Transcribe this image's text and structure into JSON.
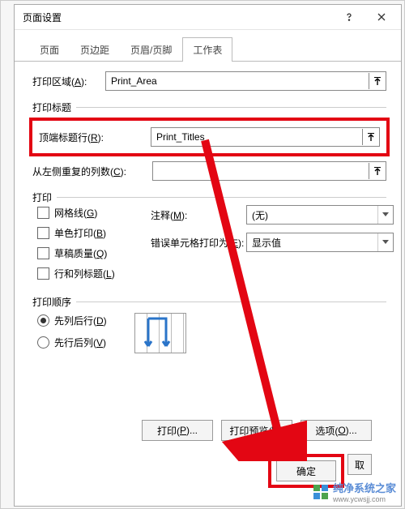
{
  "title": "页面设置",
  "tabs": [
    "页面",
    "页边距",
    "页眉/页脚",
    "工作表"
  ],
  "active_tab_index": 3,
  "print_area": {
    "label": "打印区域(A):",
    "value": "Print_Area"
  },
  "titles_group": "打印标题",
  "top_row": {
    "label": "顶端标题行(R):",
    "value": "Print_Titles"
  },
  "left_col": {
    "label": "从左侧重复的列数(C):",
    "value": ""
  },
  "print_group": "打印",
  "checks": {
    "gridlines": "网格线(G)",
    "bw": "单色打印(B)",
    "draft": "草稿质量(Q)",
    "rowcol": "行和列标题(L)"
  },
  "comments": {
    "label": "注释(M):",
    "value": "(无)"
  },
  "errors": {
    "label": "错误单元格打印为(E):",
    "value": "显示值"
  },
  "order_group": "打印顺序",
  "order": {
    "down_over": "先列后行(D)",
    "over_down": "先行后列(V)",
    "selected": "down_over"
  },
  "buttons": {
    "print": "打印(P)...",
    "preview": "打印预览(W)",
    "options": "选项(O)...",
    "ok": "确定",
    "cancel": "取"
  },
  "watermark": {
    "text": "纯净系统之家",
    "url": "www.ycwsjj.com"
  }
}
